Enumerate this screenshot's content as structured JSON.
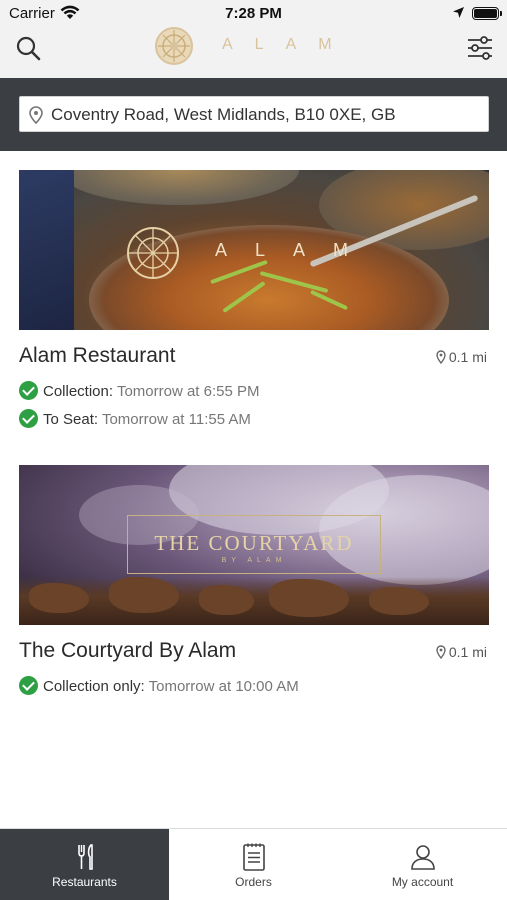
{
  "status_bar": {
    "carrier": "Carrier",
    "time": "7:28 PM"
  },
  "header": {
    "brand": "ALAM",
    "search_icon": "search-icon",
    "filter_icon": "filter-sliders-icon",
    "brand_color": "#d9c39d"
  },
  "location": {
    "address": "Coventry Road, West Midlands, B10 0XE, GB",
    "icon": "map-pin-icon"
  },
  "restaurants": [
    {
      "name": "Alam Restaurant",
      "distance": "0.1 mi",
      "image_logo_text": "ALAM",
      "services": [
        {
          "label": "Collection:",
          "time": "Tomorrow at 6:55 PM"
        },
        {
          "label": "To Seat:",
          "time": "Tomorrow at 11:55 AM"
        }
      ]
    },
    {
      "name": "The Courtyard By Alam",
      "distance": "0.1 mi",
      "image_logo_title": "THE COURTYARD",
      "image_logo_sub": "BY ALAM",
      "services": [
        {
          "label": "Collection only:",
          "time": "Tomorrow at 10:00 AM"
        }
      ]
    }
  ],
  "tabbar": {
    "items": [
      {
        "label": "Restaurants",
        "icon": "fork-knife-icon",
        "active": true
      },
      {
        "label": "Orders",
        "icon": "clipboard-list-icon",
        "active": false
      },
      {
        "label": "My account",
        "icon": "user-icon",
        "active": false
      }
    ]
  },
  "colors": {
    "dark_bar": "#3b3f44",
    "check_green": "#2ea043"
  }
}
